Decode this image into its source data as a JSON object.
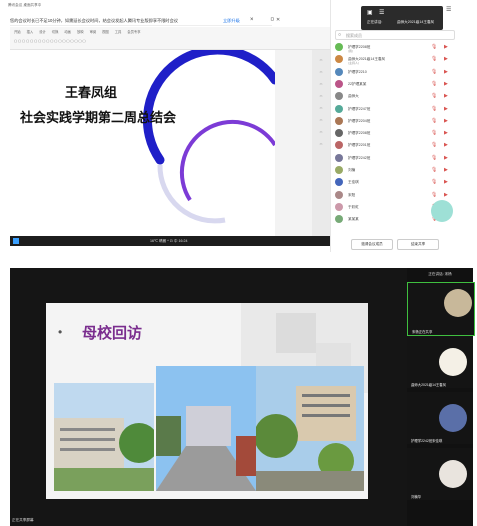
{
  "top": {
    "app_title": "腾讯会议 桌面共享中",
    "banner": {
      "text": "您的会议时长已不足10分钟，如需延长会议时间，结会议发起人腾讯专业版即享不限时会议",
      "link": "立即升级",
      "close": "×"
    },
    "window_controls": "ㅁ ✕",
    "ribbon_items": [
      "开始",
      "插入",
      "设计",
      "切换",
      "动画",
      "放映",
      "审阅",
      "视图",
      "工具",
      "会员专享"
    ],
    "slide": {
      "line1": "王春凤组",
      "line2": "社会实践学期第二周总结会"
    },
    "taskbar_text": "16℃ 晴朗  ^  ⊡  中  16:24",
    "meeting": {
      "popup_title": "正在讲话:",
      "popup_name": "曲师大2021级14王春凤",
      "search_placeholder": "搜索成员",
      "participants": [
        {
          "name": "护理学2208班",
          "sub": "(我)",
          "color": "#6b5"
        },
        {
          "name": "曲师大2021级14王春凤",
          "sub": "(主持人)",
          "color": "#c84"
        },
        {
          "name": "护理学2210",
          "sub": "",
          "color": "#58b"
        },
        {
          "name": "22护理某某",
          "sub": "",
          "color": "#b58"
        },
        {
          "name": "曲师大",
          "sub": "",
          "color": "#888"
        },
        {
          "name": "护理学2247班",
          "sub": "",
          "color": "#5a9"
        },
        {
          "name": "护理学2204班",
          "sub": "",
          "color": "#a75"
        },
        {
          "name": "护理学2208班",
          "sub": "",
          "color": "#666"
        },
        {
          "name": "护理学2201班",
          "sub": "",
          "color": "#b66"
        },
        {
          "name": "护理学2242班",
          "sub": "",
          "color": "#779"
        },
        {
          "name": "刘楠",
          "sub": "",
          "color": "#9a6"
        },
        {
          "name": "王佳琪",
          "sub": "",
          "color": "#46b"
        },
        {
          "name": "宋阳",
          "sub": "",
          "color": "#a88"
        },
        {
          "name": "于彩虹",
          "sub": "",
          "color": "#c9a"
        },
        {
          "name": "某某某",
          "sub": "",
          "color": "#7a7"
        }
      ],
      "invite_button": "邀请会议成员",
      "manage_button": "结束共享"
    }
  },
  "bottom": {
    "slide_title": "母校回访",
    "bullet": "•",
    "share_label": "正在共享屏幕",
    "tiles_header": "正在讲话: 宋杨",
    "tiles": [
      {
        "label": "宋杨正在共享"
      },
      {
        "label": "曲师大2021级14王春凤"
      },
      {
        "label": "护理学2242班宋佳琪"
      },
      {
        "label": "刘楠华"
      }
    ]
  }
}
